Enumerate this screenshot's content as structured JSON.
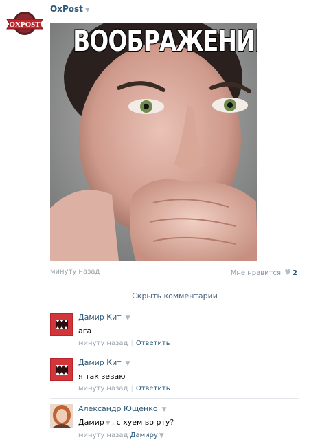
{
  "post": {
    "author": "OxPost",
    "caret": "▼",
    "brand_logo_text": "OXPOST",
    "image_caption": "ВООБРАЖЕНИЕ",
    "time": "минуту назад",
    "likes_label": "Мне нравится",
    "likes_count": "2"
  },
  "hide_comments_label": "Скрыть комментарии",
  "comments": [
    {
      "author": "Дамир Кит",
      "text": "ага",
      "time": "минуту назад",
      "reply_label": "Ответить"
    },
    {
      "author": "Дамир Кит",
      "text": "я так зеваю",
      "time": "минуту назад",
      "reply_label": "Ответить"
    },
    {
      "author": "Александр Ющенко",
      "text_name": "Дамир",
      "text_rest": ", с хуем во рту?",
      "time": "минуту назад",
      "reply_to": "Дамиру"
    }
  ],
  "colors": {
    "link": "#2b587a",
    "muted": "#9aa4ae",
    "brand_red": "#c0262b"
  },
  "icons": {
    "heart": "heart-icon",
    "caret": "chevron-down-icon"
  }
}
